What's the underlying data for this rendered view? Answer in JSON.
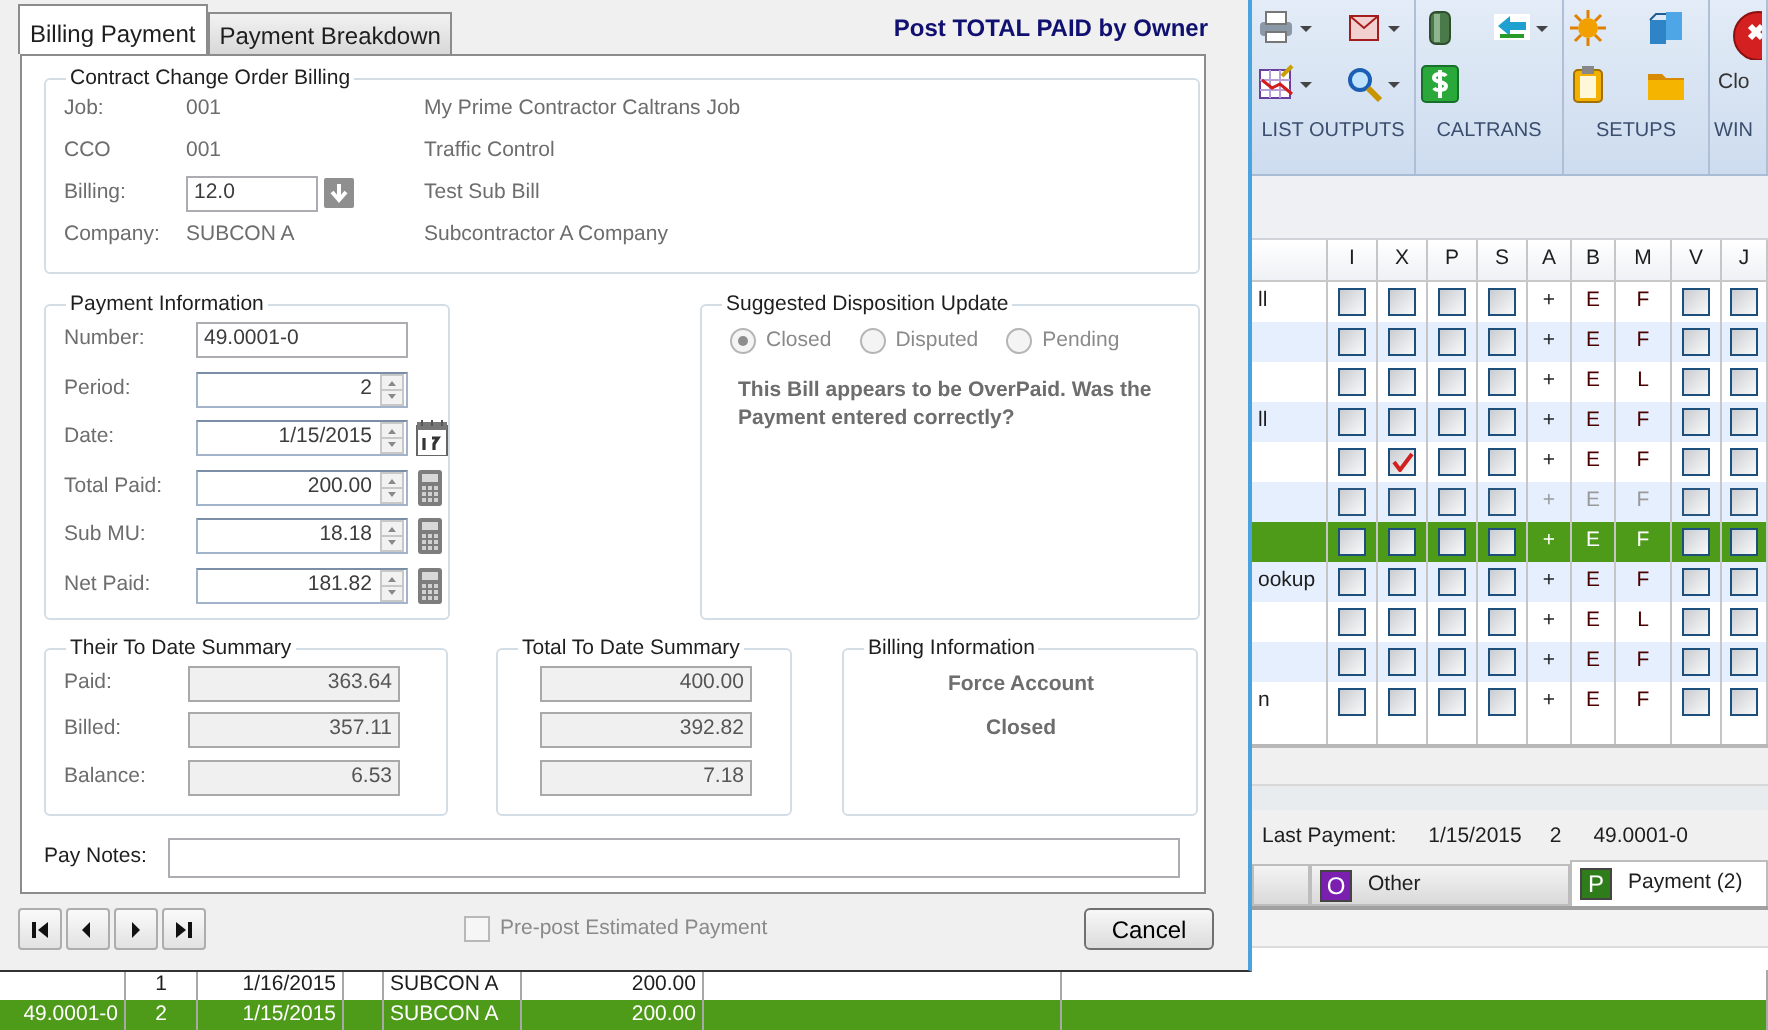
{
  "dialog": {
    "tabs": [
      {
        "label": "Billing Payment",
        "selected": true
      },
      {
        "label": "Payment Breakdown",
        "selected": false
      }
    ],
    "heading": "Post TOTAL PAID by Owner",
    "contract_group": {
      "title": "Contract Change Order Billing",
      "rows": [
        {
          "label": "Job:",
          "value": "001",
          "kind": "text",
          "description": "My Prime Contractor Caltrans Job"
        },
        {
          "label": "CCO",
          "value": "001",
          "kind": "text",
          "description": "Traffic Control"
        },
        {
          "label": "Billing:",
          "value": "12.0",
          "kind": "field",
          "description": "Test Sub Bill"
        },
        {
          "label": "Company:",
          "value": "SUBCON A",
          "kind": "text",
          "description": "Subcontractor A Company"
        }
      ]
    },
    "payment_group": {
      "title": "Payment Information",
      "fields": [
        {
          "label": "Number:",
          "value": "49.0001-0",
          "kind": "text"
        },
        {
          "label": "Period:",
          "value": "2",
          "kind": "spin"
        },
        {
          "label": "Date:",
          "value": "1/15/2015",
          "kind": "date"
        },
        {
          "label": "Total Paid:",
          "value": "200.00",
          "kind": "calc"
        },
        {
          "label": "Sub MU:",
          "value": "18.18",
          "kind": "calc"
        },
        {
          "label": "Net Paid:",
          "value": "181.82",
          "kind": "calc"
        }
      ]
    },
    "disposition_group": {
      "title": "Suggested Disposition Update",
      "disabled": true,
      "options": [
        {
          "label": "Closed",
          "selected": true
        },
        {
          "label": "Disputed",
          "selected": false
        },
        {
          "label": "Pending",
          "selected": false
        }
      ],
      "message": "This Bill appears to be OverPaid. Was the Payment entered correctly?"
    },
    "their_summary": {
      "title": "Their To Date Summary",
      "rows": [
        {
          "label": "Paid:",
          "value": "363.64"
        },
        {
          "label": "Billed:",
          "value": "357.11"
        },
        {
          "label": "Balance:",
          "value": "6.53"
        }
      ]
    },
    "total_summary": {
      "title": "Total To Date Summary",
      "values": [
        "400.00",
        "392.82",
        "7.18"
      ]
    },
    "billing_info": {
      "title": "Billing Information",
      "lines": [
        "Force Account",
        "Closed"
      ]
    },
    "pay_notes": {
      "label": "Pay Notes:"
    },
    "prepost": {
      "label": "Pre-post Estimated Payment",
      "checked": false,
      "disabled": true
    },
    "cancel": "Cancel"
  },
  "ribbon": {
    "groups": [
      "LIST OUTPUTS",
      "CALTRANS",
      "SETUPS",
      "WIN"
    ],
    "close_label": "Clo"
  },
  "grid": {
    "columns": [
      "I",
      "X",
      "P",
      "S",
      "A",
      "B",
      "M",
      "V",
      "J"
    ],
    "rows": [
      {
        "name": "ll",
        "i": false,
        "x": false,
        "p": false,
        "s": false,
        "a": "+",
        "b": "E",
        "m": "F",
        "v": false,
        "j": false,
        "selected": false,
        "disabled": false
      },
      {
        "i": false,
        "x": false,
        "p": false,
        "s": false,
        "a": "+",
        "b": "E",
        "m": "F",
        "v": false,
        "j": false,
        "selected": false,
        "disabled": false
      },
      {
        "i": false,
        "x": false,
        "p": false,
        "s": false,
        "a": "+",
        "b": "E",
        "m": "L",
        "v": false,
        "j": false,
        "selected": false,
        "disabled": false
      },
      {
        "name": "ll",
        "i": false,
        "x": false,
        "p": false,
        "s": false,
        "a": "+",
        "b": "E",
        "m": "F",
        "v": false,
        "j": false,
        "selected": false,
        "disabled": false
      },
      {
        "i": false,
        "x": true,
        "p": false,
        "s": false,
        "a": "+",
        "b": "E",
        "m": "F",
        "v": false,
        "j": false,
        "selected": false,
        "disabled": false
      },
      {
        "i": false,
        "x": false,
        "p": false,
        "s": false,
        "a": "+",
        "b": "E",
        "m": "F",
        "v": false,
        "j": false,
        "selected": false,
        "disabled": true
      },
      {
        "i": false,
        "x": false,
        "p": false,
        "s": false,
        "a": "+",
        "b": "E",
        "m": "F",
        "v": false,
        "j": false,
        "selected": true,
        "disabled": false
      },
      {
        "name": "ookup",
        "i": false,
        "x": false,
        "p": false,
        "s": false,
        "a": "+",
        "b": "E",
        "m": "F",
        "v": false,
        "j": false,
        "selected": false,
        "disabled": false
      },
      {
        "i": false,
        "x": false,
        "p": false,
        "s": false,
        "a": "+",
        "b": "E",
        "m": "L",
        "v": false,
        "j": false,
        "selected": false,
        "disabled": false
      },
      {
        "i": false,
        "x": false,
        "p": false,
        "s": false,
        "a": "+",
        "b": "E",
        "m": "F",
        "v": false,
        "j": false,
        "selected": false,
        "disabled": false
      },
      {
        "name": "n",
        "i": false,
        "x": false,
        "p": false,
        "s": false,
        "a": "+",
        "b": "E",
        "m": "F",
        "v": false,
        "j": false,
        "selected": false,
        "disabled": false
      }
    ]
  },
  "status": {
    "label": "Last Payment:",
    "date": "1/15/2015",
    "period": "2",
    "number": "49.0001-0"
  },
  "bottom_tabs": [
    {
      "label": "Other",
      "letter": "O",
      "color": "#7a1fb0",
      "selected": false
    },
    {
      "label": "Payment (2)",
      "letter": "P",
      "color": "#2f7d1a",
      "selected": true
    }
  ],
  "payments": [
    {
      "period": "1",
      "date": "1/16/2015",
      "company": "SUBCON A",
      "amount": "200.00",
      "selected": false
    },
    {
      "number": "49.0001-0",
      "period": "2",
      "date": "1/15/2015",
      "company": "SUBCON A",
      "amount": "200.00",
      "selected": true
    }
  ]
}
